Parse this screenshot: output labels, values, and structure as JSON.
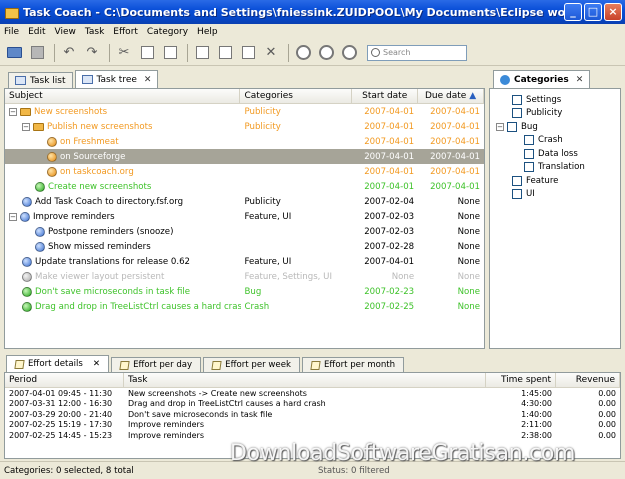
{
  "window": {
    "title": "Task Coach - C:\\Documents and Settings\\fniessink.ZUIDPOOL\\My Documents\\Eclipse workspace\\Task Coach\\T..."
  },
  "menu": [
    "File",
    "Edit",
    "View",
    "Task",
    "Effort",
    "Category",
    "Help"
  ],
  "toolbar": {
    "search_placeholder": "Search"
  },
  "task_tabs": [
    {
      "label": "Task list"
    },
    {
      "label": "Task tree"
    }
  ],
  "task_columns": {
    "subject": "Subject",
    "categories": "Categories",
    "start": "Start date",
    "due": "Due date"
  },
  "tasks": [
    {
      "subject": "New screenshots",
      "categories": "Publicity",
      "start": "2007-04-01",
      "due": "2007-04-01"
    },
    {
      "subject": "Publish new screenshots",
      "categories": "Publicity",
      "start": "2007-04-01",
      "due": "2007-04-01"
    },
    {
      "subject": "on Freshmeat",
      "categories": "",
      "start": "2007-04-01",
      "due": "2007-04-01"
    },
    {
      "subject": "on Sourceforge",
      "categories": "",
      "start": "2007-04-01",
      "due": "2007-04-01"
    },
    {
      "subject": "on taskcoach.org",
      "categories": "",
      "start": "2007-04-01",
      "due": "2007-04-01"
    },
    {
      "subject": "Create new screenshots",
      "categories": "",
      "start": "2007-04-01",
      "due": "2007-04-01"
    },
    {
      "subject": "Add Task Coach to directory.fsf.org",
      "categories": "Publicity",
      "start": "2007-02-04",
      "due": "None"
    },
    {
      "subject": "Improve reminders",
      "categories": "Feature, UI",
      "start": "2007-02-03",
      "due": "None"
    },
    {
      "subject": "Postpone reminders (snooze)",
      "categories": "",
      "start": "2007-02-03",
      "due": "None"
    },
    {
      "subject": "Show missed reminders",
      "categories": "",
      "start": "2007-02-28",
      "due": "None"
    },
    {
      "subject": "Update translations for release 0.62",
      "categories": "Feature, UI",
      "start": "2007-04-01",
      "due": "None"
    },
    {
      "subject": "Make viewer layout persistent",
      "categories": "Feature, Settings, UI",
      "start": "None",
      "due": "None"
    },
    {
      "subject": "Don't save microseconds in task file",
      "categories": "Bug",
      "start": "2007-02-23",
      "due": "None"
    },
    {
      "subject": "Drag and drop in TreeListCtrl causes a hard crash",
      "categories": "Crash",
      "start": "2007-02-25",
      "due": "None"
    }
  ],
  "categories_panel": {
    "title": "Categories",
    "items": [
      {
        "label": "Settings"
      },
      {
        "label": "Publicity"
      },
      {
        "label": "Bug"
      },
      {
        "label": "Crash"
      },
      {
        "label": "Data loss"
      },
      {
        "label": "Translation"
      },
      {
        "label": "Feature"
      },
      {
        "label": "UI"
      }
    ]
  },
  "effort_tabs": [
    {
      "label": "Effort details"
    },
    {
      "label": "Effort per day"
    },
    {
      "label": "Effort per week"
    },
    {
      "label": "Effort per month"
    }
  ],
  "effort_columns": {
    "period": "Period",
    "task": "Task",
    "time": "Time spent",
    "revenue": "Revenue"
  },
  "efforts": [
    {
      "period": "2007-04-01 09:45 - 11:30",
      "task": "New screenshots -> Create new screenshots",
      "time": "1:45:00",
      "revenue": "0.00"
    },
    {
      "period": "2007-03-31 12:00 - 16:30",
      "task": "Drag and drop in TreeListCtrl causes a hard crash",
      "time": "4:30:00",
      "revenue": "0.00"
    },
    {
      "period": "2007-03-29 20:00 - 21:40",
      "task": "Don't save microseconds in task file",
      "time": "1:40:00",
      "revenue": "0.00"
    },
    {
      "period": "2007-02-25 15:19 - 17:30",
      "task": "Improve reminders",
      "time": "2:11:00",
      "revenue": "0.00"
    },
    {
      "period": "2007-02-25 14:45 - 15:23",
      "task": "Improve reminders",
      "time": "2:38:00",
      "revenue": "0.00"
    }
  ],
  "status": {
    "left": "Categories: 0 selected, 8 total",
    "right": "Status: 0 filtered"
  },
  "watermark": "DownloadSoftwareGratisan.com"
}
